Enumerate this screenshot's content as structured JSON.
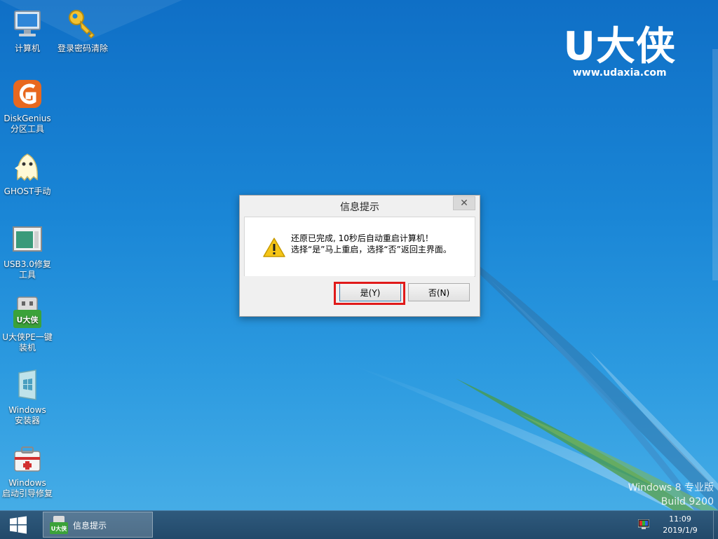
{
  "desktop": {
    "icons": [
      {
        "label": "计算机",
        "icon": "computer-icon"
      },
      {
        "label": "登录密码清除",
        "icon": "key-icon"
      },
      {
        "label": "DiskGenius\n分区工具",
        "icon": "diskgenius-icon"
      },
      {
        "label": "GHOST手动",
        "icon": "ghost-icon"
      },
      {
        "label": "USB3.0修复\n工具",
        "icon": "usb-repair-icon"
      },
      {
        "label": "U大侠PE一键\n装机",
        "icon": "udaxia-installer-icon"
      },
      {
        "label": "Windows\n安装器",
        "icon": "windows-installer-icon"
      },
      {
        "label": "Windows\n启动引导修复",
        "icon": "boot-repair-icon"
      }
    ],
    "brand": {
      "logo": "U大侠",
      "url": "www.udaxia.com"
    },
    "watermark": {
      "line1": "Windows 8 专业版",
      "line2": "Build 9200"
    }
  },
  "dialog": {
    "title": "信息提示",
    "close_glyph": "✕",
    "message_line1": "还原已完成, 10秒后自动重启计算机！",
    "message_line2": "选择“是”马上重启，选择“否”返回主界面。",
    "yes_label": "是(Y)",
    "no_label": "否(N)",
    "icon": "warning-icon"
  },
  "taskbar": {
    "start_icon": "windows-start-icon",
    "task_label": "信息提示",
    "task_icon_text": "U大侠",
    "time": "11:09",
    "date": "2019/1/9"
  },
  "colors": {
    "highlight": "#e01a1a",
    "desktop_blue": "#1a86d6",
    "taskbar": "#2f5a7d"
  }
}
